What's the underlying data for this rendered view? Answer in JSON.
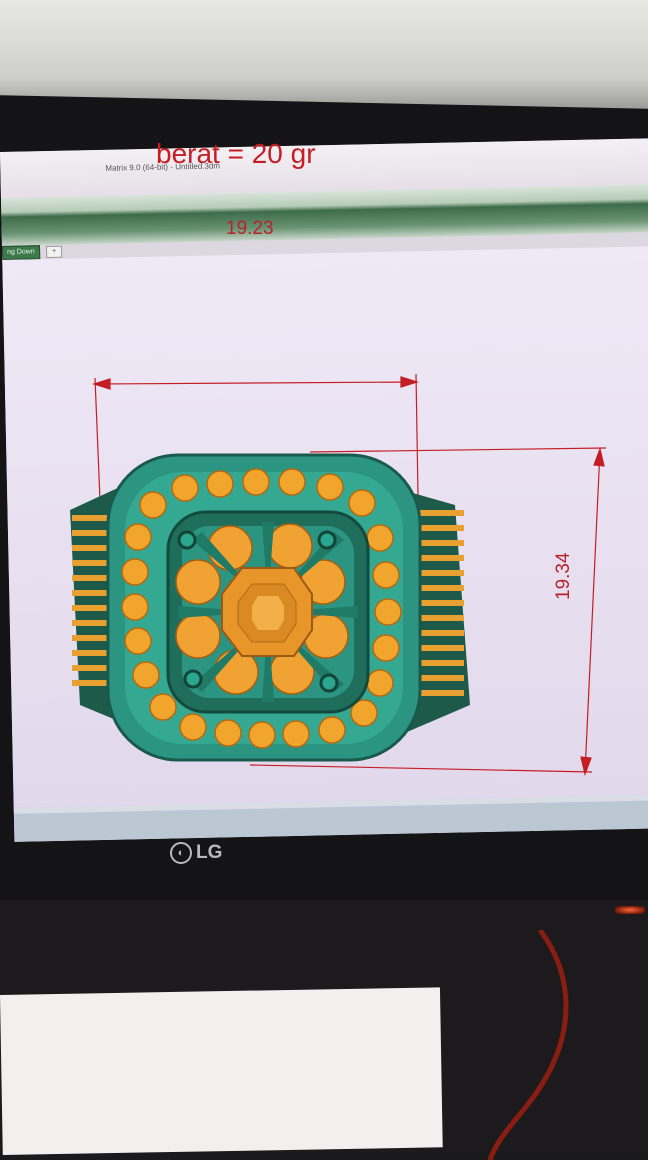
{
  "window": {
    "title": "Matrix 9.0 (64-bit) - Untitled.3dm"
  },
  "tabs": [
    {
      "label": "ng Down"
    }
  ],
  "annotations": {
    "weight": "berat =  20 gr",
    "width_dimension": "19.23",
    "height_dimension": "19.34"
  },
  "monitor": {
    "brand": "LG",
    "logo_mark": "◐"
  },
  "colors": {
    "dimension_red": "#c51d24",
    "metal_teal": "#2f9a86",
    "gem_orange": "#f2a52c"
  }
}
